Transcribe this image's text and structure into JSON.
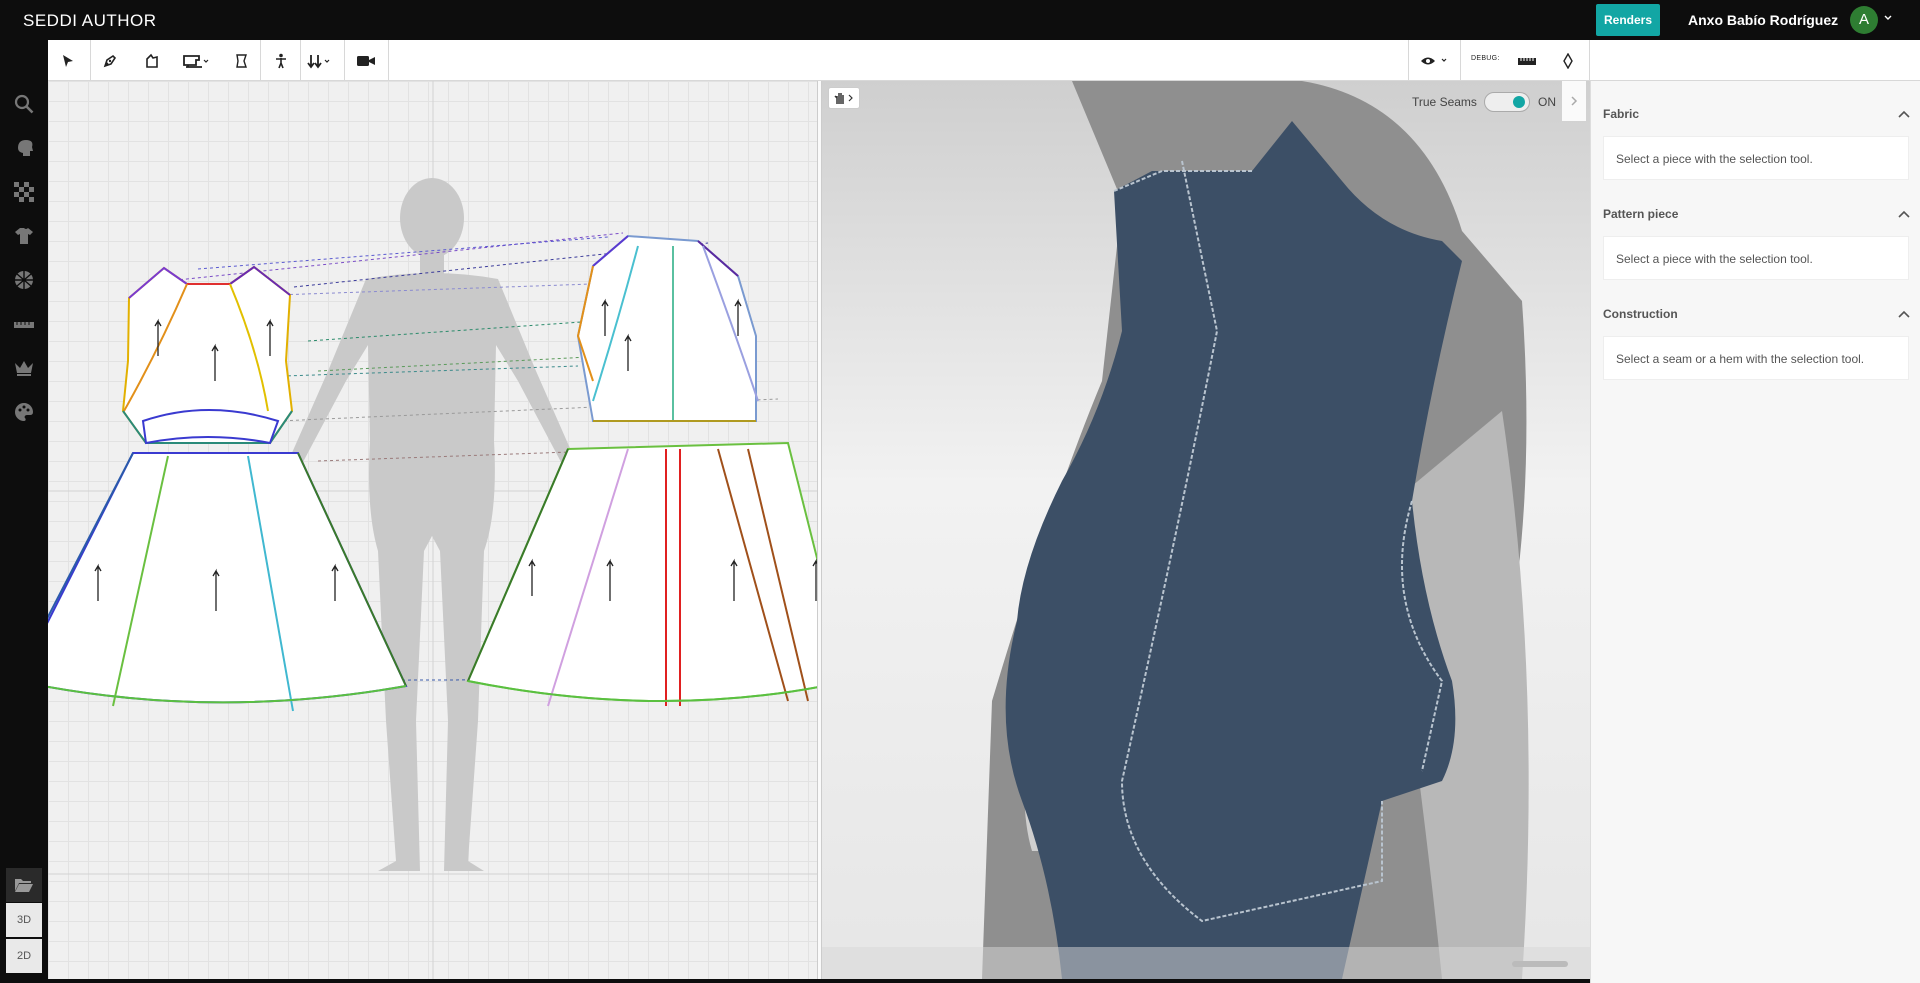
{
  "app": {
    "logo": "SEDDI AUTHOR"
  },
  "topbar": {
    "renders_label": "Renders",
    "user_name": "Anxo Babío Rodríguez",
    "avatar_initial": "A"
  },
  "toolbar": {
    "tools": [
      "select-arrow-icon",
      "pen-icon",
      "piece-icon",
      "sewing-machine-icon",
      "bounds-icon",
      "avatar-figure-icon",
      "sort-arrows-icon",
      "camera-icon"
    ],
    "debug_label": "DEBUG:"
  },
  "sidebar": {
    "icons": [
      "search-icon",
      "head-icon",
      "fabric-checker-icon",
      "garment-shirt-icon",
      "material-ball-icon",
      "measure-ruler-icon",
      "crown-icon",
      "palette-icon",
      "folder-open-icon"
    ],
    "view_3d": "3D",
    "view_2d": "2D"
  },
  "viewer3d": {
    "true_seams_label": "True Seams",
    "true_seams_state": "ON",
    "true_seams_on": true
  },
  "panel": {
    "sections": [
      {
        "title": "Fabric",
        "hint": "Select a piece with the selection tool."
      },
      {
        "title": "Pattern piece",
        "hint": "Select a piece with the selection tool."
      },
      {
        "title": "Construction",
        "hint": "Select a seam or a hem with the selection tool."
      }
    ]
  },
  "colors": {
    "accent": "#12a6a4",
    "topbar_bg": "#0d0d0d",
    "denim": "#3c4f66",
    "avatar_bg": "#2e7d32"
  }
}
